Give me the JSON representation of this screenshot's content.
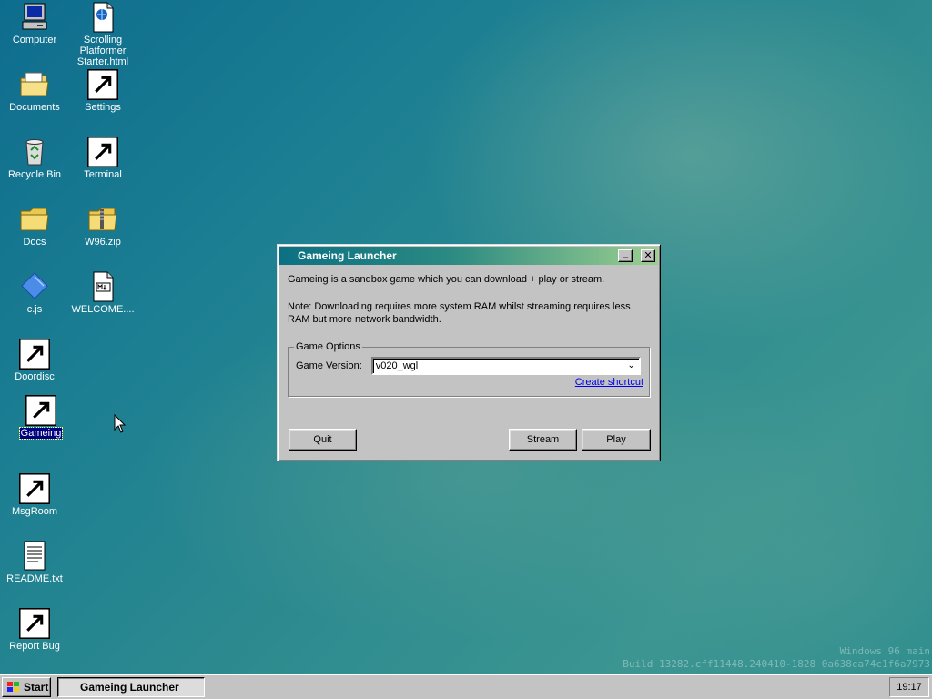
{
  "desktop": {
    "icons": [
      {
        "label": "Computer",
        "icon": "computer-icon",
        "shortcut": false
      },
      {
        "label": "Scrolling Platformer Starter.html",
        "icon": "html-file-icon",
        "shortcut": false
      },
      {
        "label": "Documents",
        "icon": "documents-folder-icon",
        "shortcut": false
      },
      {
        "label": "Settings",
        "icon": "settings-icon",
        "shortcut": true
      },
      {
        "label": "Recycle Bin",
        "icon": "recycle-bin-icon",
        "shortcut": false
      },
      {
        "label": "Terminal",
        "icon": "terminal-icon",
        "shortcut": true
      },
      {
        "label": "Docs",
        "icon": "folder-icon",
        "shortcut": false
      },
      {
        "label": "W96.zip",
        "icon": "zip-folder-icon",
        "shortcut": false
      },
      {
        "label": "c.js",
        "icon": "js-file-icon",
        "shortcut": false
      },
      {
        "label": "WELCOME....",
        "icon": "markdown-file-icon",
        "shortcut": false
      },
      {
        "label": "Doordisc",
        "icon": "doordisc-icon",
        "shortcut": true
      },
      {
        "label": "Gameing",
        "icon": "gameing-cube-icon",
        "shortcut": true,
        "selected": true
      },
      {
        "label": "MsgRoom",
        "icon": "msgroom-icon",
        "shortcut": true
      },
      {
        "label": "README.txt",
        "icon": "text-file-icon",
        "shortcut": false
      },
      {
        "label": "Report Bug",
        "icon": "report-bug-icon",
        "shortcut": true
      }
    ],
    "watermark": {
      "line1": "Windows 96 main",
      "line2": "Build 13282.cff11448.240410-1828 0a638ca74c1f6a7973"
    }
  },
  "launcher": {
    "title": "Gameing Launcher",
    "minimize_label": "_",
    "close_label": "✕",
    "description": "Gameing is a sandbox game which you can download + play or stream.",
    "note": "Note: Downloading requires more system RAM whilst streaming requires less RAM but more network bandwidth.",
    "options_legend": "Game Options",
    "version_label": "Game Version:",
    "version_value": "v020_wgl",
    "create_shortcut": "Create shortcut",
    "quit": "Quit",
    "stream": "Stream",
    "play": "Play"
  },
  "taskbar": {
    "start": "Start",
    "task_label": "Gameing Launcher",
    "clock": "19:17"
  },
  "colors": {
    "title_start": "#0b7083",
    "title_end": "#9ccf8f",
    "face": "#c3c3c3",
    "selection": "#000080"
  }
}
